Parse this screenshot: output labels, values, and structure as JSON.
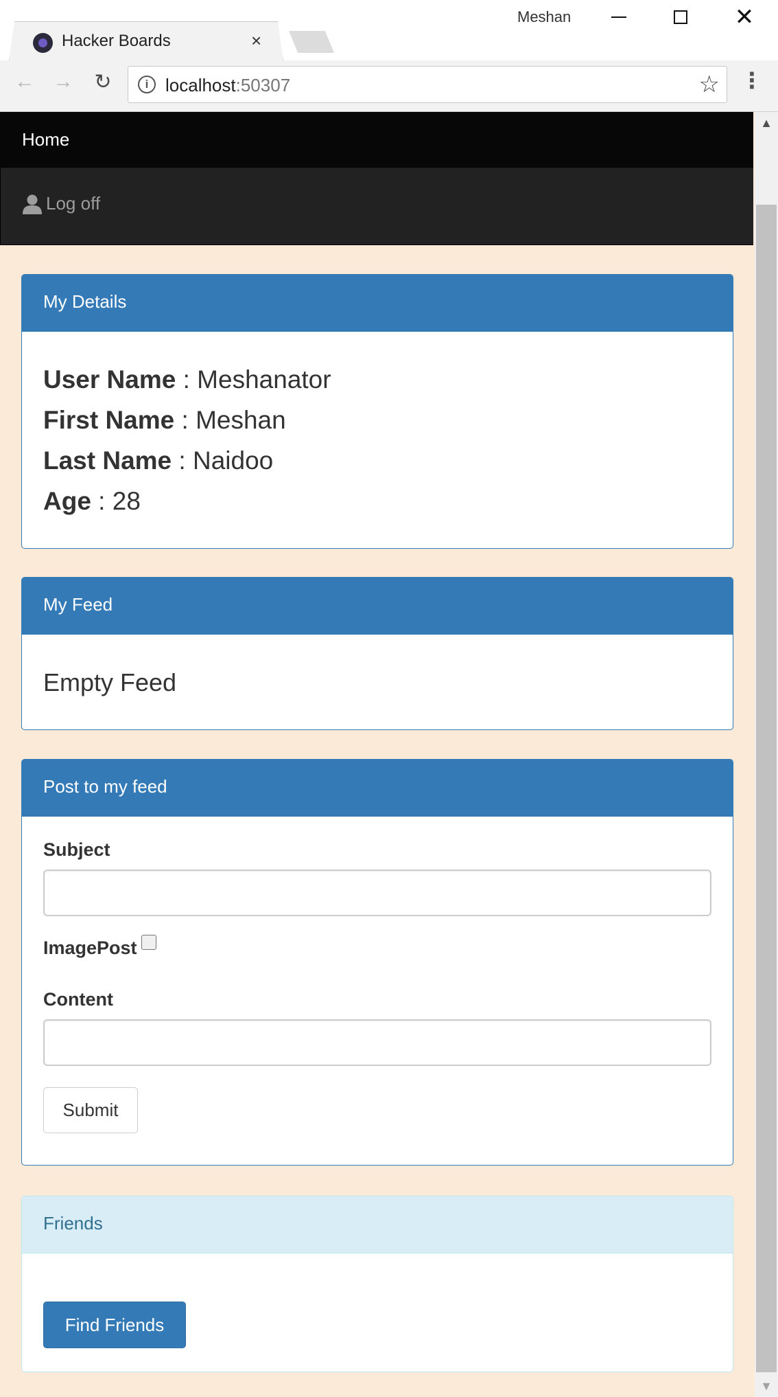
{
  "browser": {
    "tab_title": "Hacker Boards",
    "tab_close": "×",
    "profile_name": "Meshan",
    "url_host": "localhost",
    "url_port": ":50307"
  },
  "window_controls": {
    "close": "✕"
  },
  "nav_icons": {
    "back": "←",
    "forward": "→",
    "reload": "↻",
    "info": "i",
    "star": "☆",
    "menu": "⋮"
  },
  "navbar": {
    "brand": "Home",
    "logoff": "Log off"
  },
  "details_panel": {
    "heading": "My Details",
    "rows": [
      {
        "label": "User Name",
        "value": " : Meshanator"
      },
      {
        "label": "First Name",
        "value": " : Meshan"
      },
      {
        "label": "Last Name",
        "value": " : Naidoo"
      },
      {
        "label": "Age",
        "value": " : 28"
      }
    ]
  },
  "feed_panel": {
    "heading": "My Feed",
    "empty_text": "Empty Feed"
  },
  "post_panel": {
    "heading": "Post to my feed",
    "subject_label": "Subject",
    "subject_value": "",
    "imagepost_label": "ImagePost",
    "imagepost_checked": false,
    "content_label": "Content",
    "content_value": "",
    "submit_label": "Submit"
  },
  "friends_panel": {
    "heading": "Friends",
    "find_button": "Find Friends"
  },
  "colors": {
    "page_background": "#fbead7",
    "primary": "#337ab7",
    "info_heading": "#d9edf7",
    "navbar": "#222222"
  },
  "scrollbar": {
    "up": "▲",
    "down": "▼"
  }
}
